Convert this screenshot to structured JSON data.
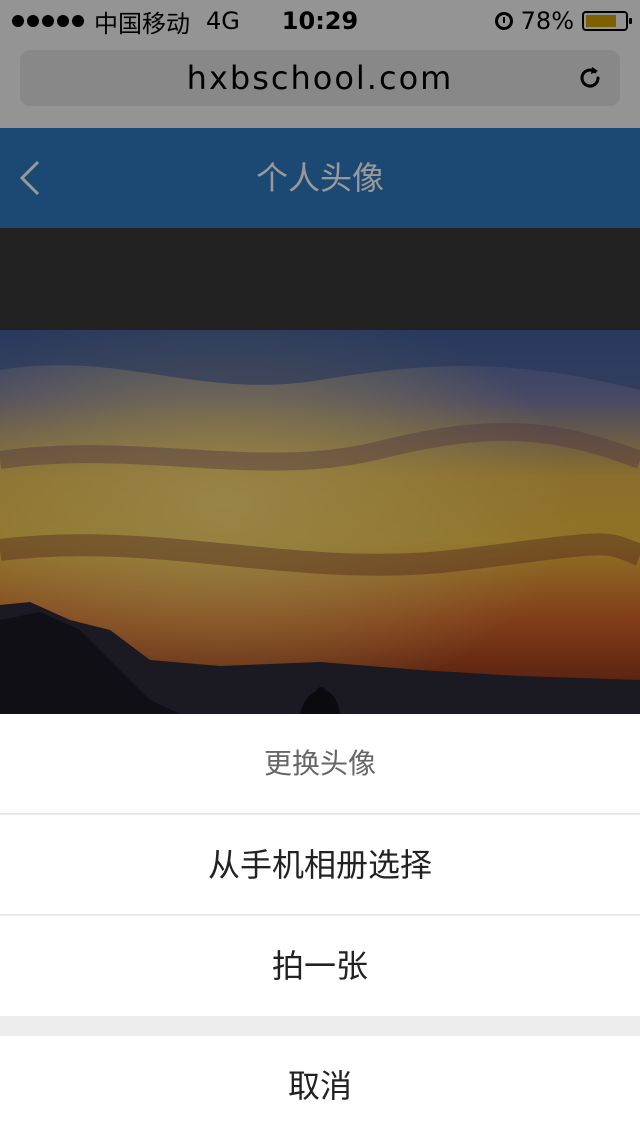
{
  "status_bar": {
    "carrier": "中国移动",
    "network": "4G",
    "time": "10:29",
    "battery_percent": "78%",
    "battery_level": 0.78,
    "icons": [
      "signal-dots-icon",
      "alarm-icon",
      "battery-icon"
    ]
  },
  "browser": {
    "url": "hxbschool.com",
    "reload_icon": "reload-icon"
  },
  "app": {
    "title": "个人头像",
    "back_icon": "back-chevron-icon",
    "theme_color": "#2d7bc0"
  },
  "action_sheet": {
    "title": "更换头像",
    "options": [
      "从手机相册选择",
      "拍一张"
    ],
    "cancel": "取消"
  }
}
